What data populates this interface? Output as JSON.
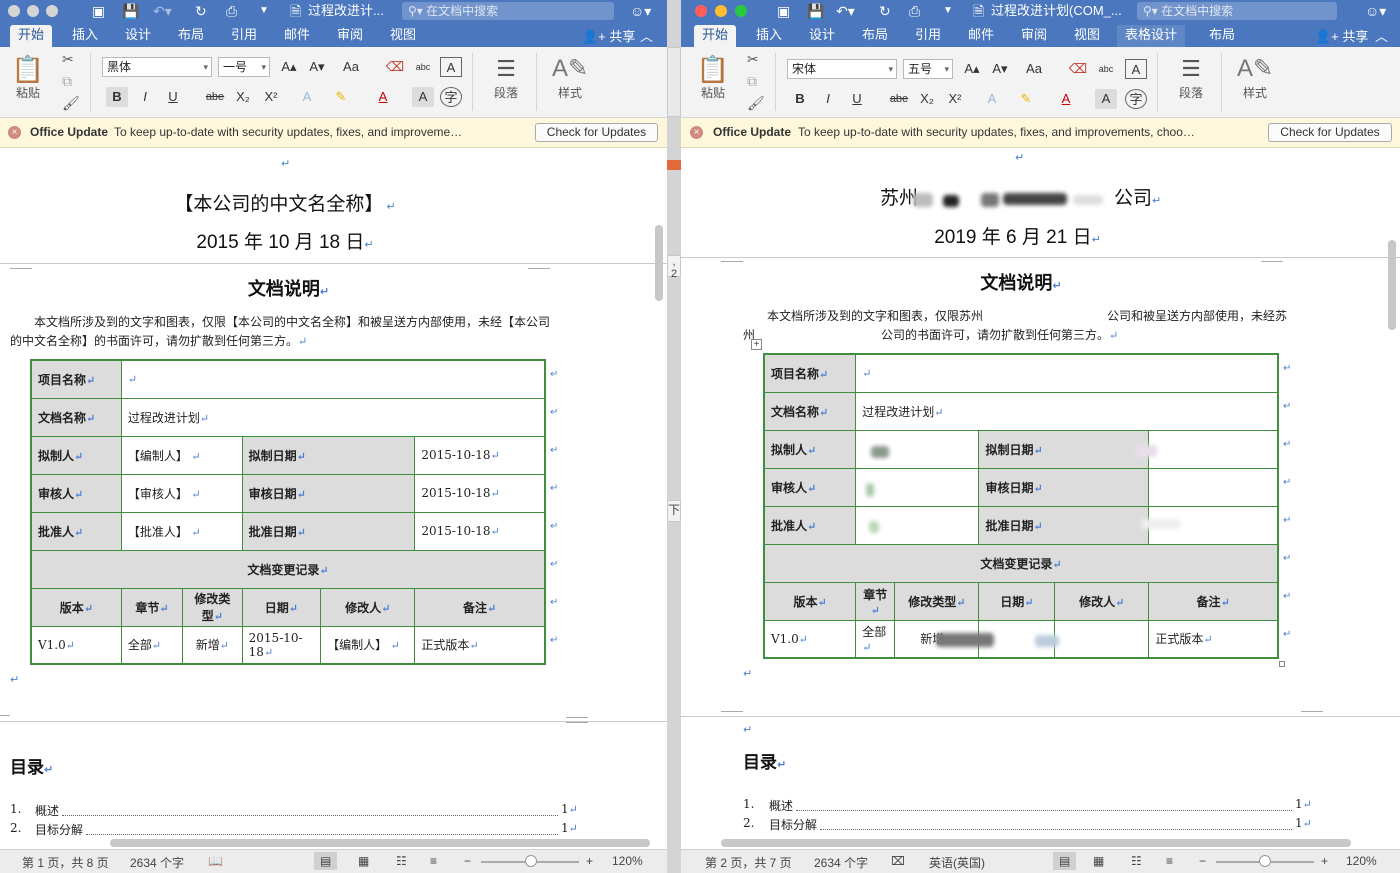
{
  "window_left": {
    "title": "过程改进计...",
    "search_placeholder": "在文档中搜索",
    "tabs": [
      "开始",
      "插入",
      "设计",
      "布局",
      "引用",
      "邮件",
      "审阅",
      "视图"
    ],
    "active_tab": "开始",
    "share": "共享",
    "font_name": "黑体",
    "font_size": "一号",
    "paste_label": "粘贴",
    "paragraph_label": "段落",
    "styles_label": "样式",
    "update_title": "Office Update",
    "update_msg": "To keep up-to-date with security updates, fixes, and improveme…",
    "update_btn": "Check for Updates",
    "company": "【本公司的中文名全称】",
    "date": "2015 年 10 月 18 日",
    "section_title": "文档说明",
    "para_line1": "本文档所涉及到的文字和图表，仅限【本公司的中文名全称】和被呈送方内部使用，未经【本公司",
    "para_line2": "的中文名全称】的书面许可，请勿扩散到任何第三方。",
    "table": {
      "project_label": "项目名称",
      "project_value": "",
      "doc_label": "文档名称",
      "doc_value": "过程改进计划",
      "author_label": "拟制人",
      "author_value": "【编制人】",
      "author_date_label": "拟制日期",
      "author_date_value": "2015-10-18",
      "reviewer_label": "审核人",
      "reviewer_value": "【审核人】",
      "review_date_label": "审核日期",
      "review_date_value": "2015-10-18",
      "approver_label": "批准人",
      "approver_value": "【批准人】",
      "approve_date_label": "批准日期",
      "approve_date_value": "2015-10-18",
      "change_log": "文档变更记录",
      "headers": [
        "版本",
        "章节",
        "修改类型",
        "日期",
        "修改人",
        "备注"
      ],
      "row": [
        "V1.0",
        "全部",
        "新增",
        "2015-10-18",
        "【编制人】",
        "正式版本"
      ]
    },
    "toc_title": "目录",
    "toc": [
      {
        "num": "1.",
        "text": "概述",
        "page": "1"
      },
      {
        "num": "2.",
        "text": "目标分解",
        "page": "1"
      }
    ],
    "status": {
      "page": "第 1 页，共 8 页",
      "words": "2634 个字",
      "zoom": "120%"
    }
  },
  "window_right": {
    "title": "过程改进计划(COM_...",
    "search_placeholder": "在文档中搜索",
    "tabs": [
      "开始",
      "插入",
      "设计",
      "布局",
      "引用",
      "邮件",
      "审阅",
      "视图",
      "表格设计",
      "布局"
    ],
    "active_tab": "开始",
    "share": "共享",
    "font_name": "宋体",
    "font_size": "五号",
    "paste_label": "粘贴",
    "paragraph_label": "段落",
    "styles_label": "样式",
    "update_title": "Office Update",
    "update_msg": "To keep up-to-date with security updates, fixes, and improvements, choo…",
    "update_btn": "Check for Updates",
    "company_start": "苏州",
    "company_end": "公司",
    "date": "2019 年 6 月 21 日",
    "section_title": "文档说明",
    "para_line1a": "本文档所涉及到的文字和图表，仅限苏州",
    "para_line1b": "公司和被呈送方内部使用，未经苏",
    "para_line2a": "州",
    "para_line2b": "公司的书面许可，请勿扩散到任何第三方。",
    "table": {
      "project_label": "项目名称",
      "doc_label": "文档名称",
      "doc_value": "过程改进计划",
      "author_label": "拟制人",
      "author_date_label": "拟制日期",
      "reviewer_label": "审核人",
      "review_date_label": "审核日期",
      "approver_label": "批准人",
      "approve_date_label": "批准日期",
      "change_log": "文档变更记录",
      "headers": [
        "版本",
        "章节",
        "修改类型",
        "日期",
        "修改人",
        "备注"
      ],
      "row": [
        "V1.0",
        "全部",
        "新增",
        "",
        "",
        "正式版本"
      ]
    },
    "toc_title": "目录",
    "toc": [
      {
        "num": "1.",
        "text": "概述",
        "page": "1"
      },
      {
        "num": "2.",
        "text": "目标分解",
        "page": "1"
      }
    ],
    "status": {
      "page": "第 2 页，共 7 页",
      "words": "2634 个字",
      "lang": "英语(英国)",
      "zoom": "120%"
    }
  },
  "divider_labels": [
    ", 2",
    "下"
  ],
  "icons": {
    "share": "person-plus-icon",
    "search": "magnifier-icon",
    "close": "close-circle-icon"
  },
  "colors": {
    "titlebar": "#4b77be",
    "table_border": "#3f8f3f",
    "label_cell": "#dcdcdc",
    "update_bar": "#fdf8dc"
  }
}
